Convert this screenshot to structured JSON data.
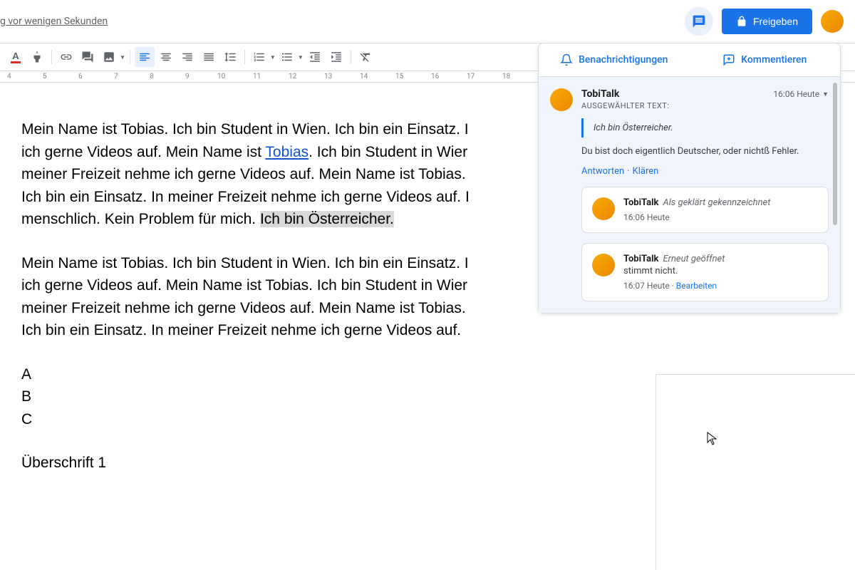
{
  "header": {
    "last_edit": "g vor wenigen Sekunden",
    "share_label": "Freigeben"
  },
  "ruler": [
    "4",
    "5",
    "6",
    "7",
    "8",
    "9",
    "10",
    "11",
    "12",
    "13",
    "14",
    "15",
    "16",
    "17",
    "18"
  ],
  "document": {
    "p1_a": "Mein Name ist Tobias. Ich bin Student in Wien. Ich bin ein Einsatz. I",
    "p1_b": "ich gerne Videos auf. Mein Name ist ",
    "link_text": "Tobias",
    "p1_c": ". Ich bin Student in Wier",
    "p1_d": "meiner Freizeit nehme ich gerne Videos auf. Mein Name ist Tobias. ",
    "p1_e": "Ich bin ein Einsatz. In meiner Freizeit nehme ich gerne Videos auf. I",
    "p1_f": "menschlich. Kein Problem für mich. ",
    "highlighted": "Ich bin Österreicher.",
    "p2_a": "Mein Name ist Tobias. Ich bin Student in Wien. Ich bin ein Einsatz. I",
    "p2_b": "ich gerne Videos auf. Mein Name ist Tobias. Ich bin Student in Wier",
    "p2_c": "meiner Freizeit nehme ich gerne Videos auf. Mein Name ist Tobias. ",
    "p2_d": "Ich bin ein Einsatz. In meiner Freizeit nehme ich gerne Videos auf.",
    "list_a": "A",
    "list_b": "B",
    "list_c": "C",
    "heading": "Überschrift 1"
  },
  "panel": {
    "tab_notifications": "Benachrichtigungen",
    "tab_comment": "Kommentieren",
    "thread": {
      "author": "TobiTalk",
      "time": "16:06 Heute",
      "selected_label": "AUSGEWÄHLTER TEXT:",
      "quote": "Ich bin Österreicher.",
      "text": "Du bist doch eigentlich Deutscher, oder nichtß Fehler.",
      "reply": "Antworten",
      "resolve": "Klären"
    },
    "sub1": {
      "author": "TobiTalk",
      "status": "Als geklärt gekennzeichnet",
      "time": "16:06 Heute"
    },
    "sub2": {
      "author": "TobiTalk",
      "status": "Erneut geöffnet",
      "text": "stimmt nicht.",
      "time": "16:07 Heute",
      "edit": "Bearbeiten"
    }
  }
}
